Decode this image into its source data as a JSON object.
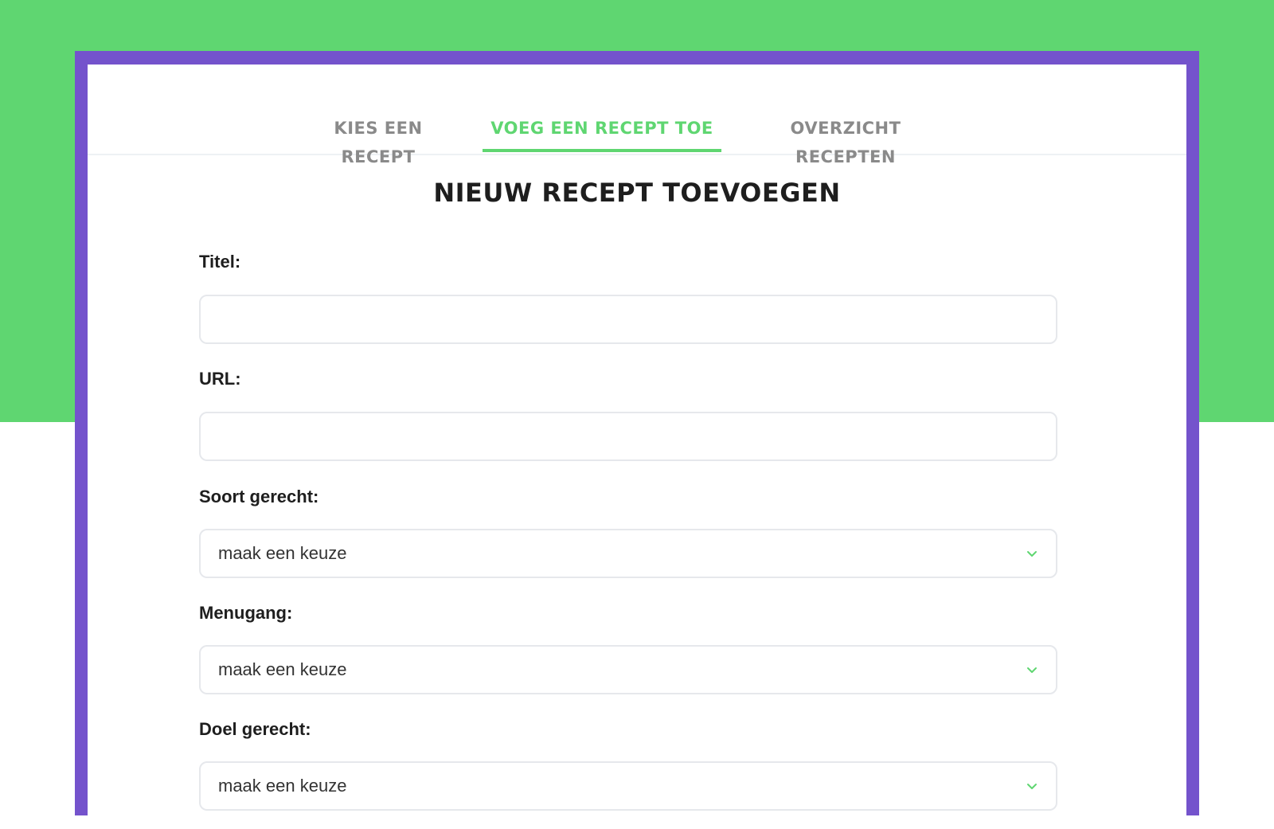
{
  "tabs": [
    {
      "label": "KIES EEN RECEPT",
      "active": false
    },
    {
      "label": "VOEG EEN RECEPT TOE",
      "active": true
    },
    {
      "label": "OVERZICHT RECEPTEN",
      "active": false
    }
  ],
  "page_title": "NIEUW RECEPT TOEVOEGEN",
  "form": {
    "titel": {
      "label": "Titel:",
      "value": "",
      "placeholder": ""
    },
    "url": {
      "label": "URL:",
      "value": "",
      "placeholder": ""
    },
    "soort_gerecht": {
      "label": "Soort gerecht:",
      "selected": "maak een keuze"
    },
    "menugang": {
      "label": "Menugang:",
      "selected": "maak een keuze"
    },
    "doel_gerecht": {
      "label": "Doel gerecht:",
      "selected": "maak een keuze"
    }
  },
  "colors": {
    "accent_green": "#5fd671",
    "frame_purple": "#7453cc",
    "tab_inactive": "#8a8a8a",
    "text_dark": "#1e1e1e"
  },
  "icons": {
    "select_chevron": "chevron-down-icon"
  }
}
